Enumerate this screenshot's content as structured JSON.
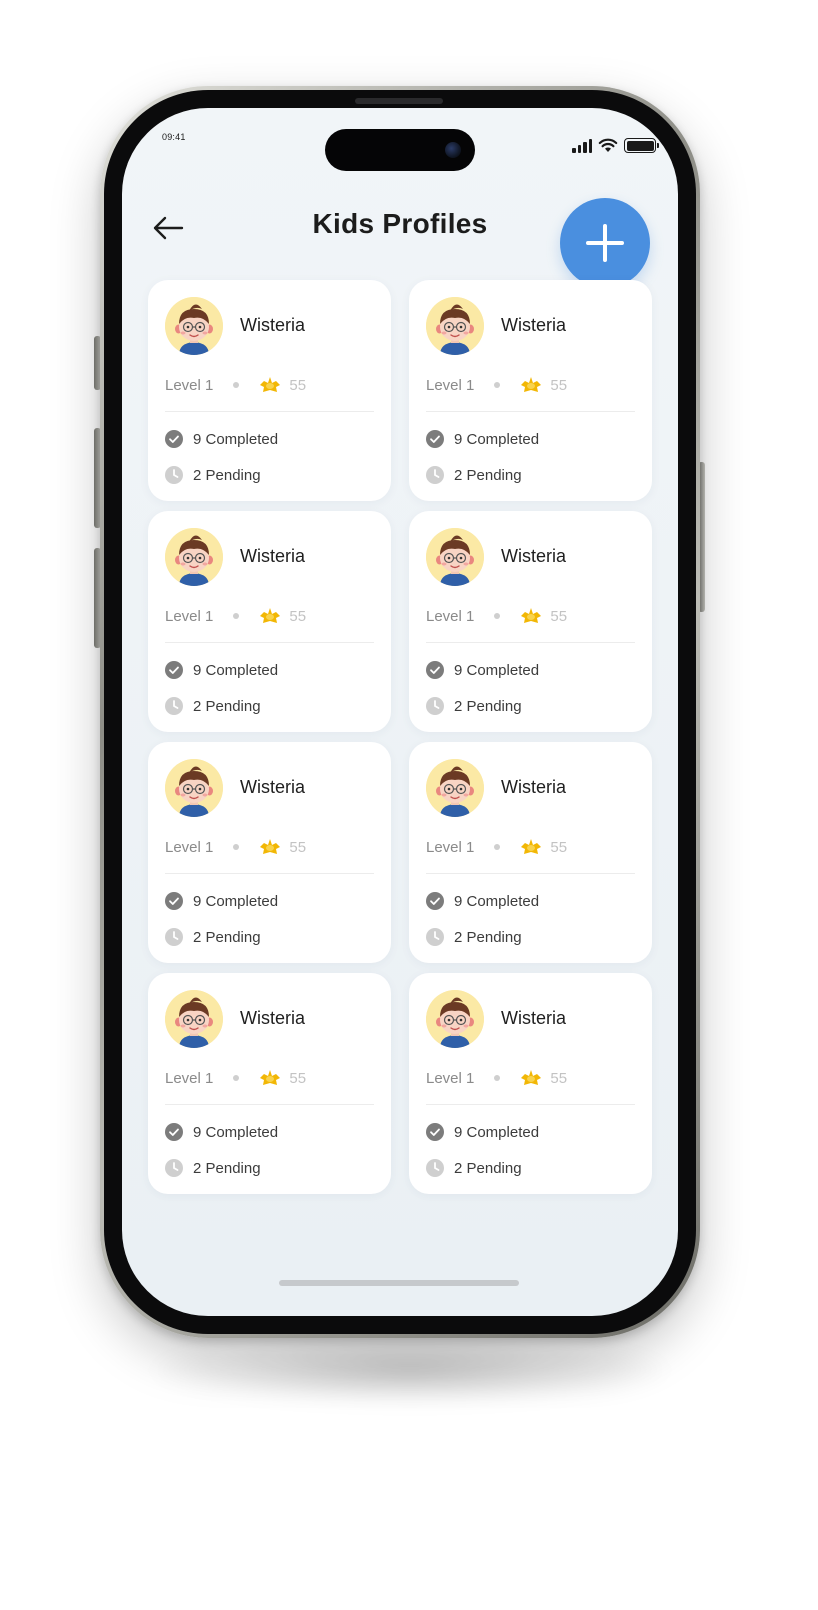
{
  "status_bar": {
    "time": "09:41"
  },
  "header": {
    "title": "Kids Profiles"
  },
  "profiles": [
    {
      "name": "Wisteria",
      "level": "Level 1",
      "coins": "55",
      "completed": "9 Completed",
      "pending": "2 Pending"
    },
    {
      "name": "Wisteria",
      "level": "Level 1",
      "coins": "55",
      "completed": "9 Completed",
      "pending": "2 Pending"
    },
    {
      "name": "Wisteria",
      "level": "Level 1",
      "coins": "55",
      "completed": "9 Completed",
      "pending": "2 Pending"
    },
    {
      "name": "Wisteria",
      "level": "Level 1",
      "coins": "55",
      "completed": "9 Completed",
      "pending": "2 Pending"
    },
    {
      "name": "Wisteria",
      "level": "Level 1",
      "coins": "55",
      "completed": "9 Completed",
      "pending": "2 Pending"
    },
    {
      "name": "Wisteria",
      "level": "Level 1",
      "coins": "55",
      "completed": "9 Completed",
      "pending": "2 Pending"
    },
    {
      "name": "Wisteria",
      "level": "Level 1",
      "coins": "55",
      "completed": "9 Completed",
      "pending": "2 Pending"
    },
    {
      "name": "Wisteria",
      "level": "Level 1",
      "coins": "55",
      "completed": "9 Completed",
      "pending": "2 Pending"
    }
  ],
  "icons": {
    "back": "arrow-left-icon",
    "add": "plus-icon",
    "coin": "coin-icon",
    "completed": "check-circle-icon",
    "pending": "clock-icon"
  },
  "colors": {
    "accent": "#4a8fdf",
    "coin": "#f2b705",
    "screen_bg": "#eef3f7",
    "card_bg": "#ffffff",
    "avatar_bg": "#fbe9a5"
  }
}
